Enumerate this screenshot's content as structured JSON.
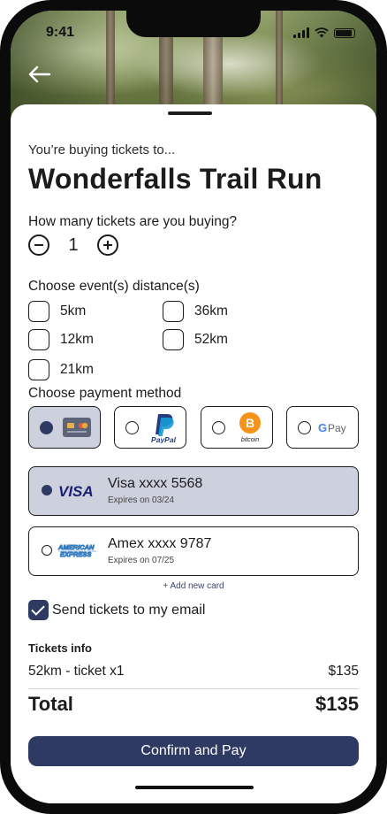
{
  "status_bar": {
    "time": "9:41"
  },
  "header": {
    "back_icon": "arrow-left-icon"
  },
  "sheet": {
    "subtitle": "You’re buying tickets to...",
    "title": "Wonderfalls Trail Run"
  },
  "tickets": {
    "question": "How many tickets are you buying?",
    "quantity": "1",
    "minus_icon": "minus-circle-icon",
    "plus_icon": "plus-circle-icon"
  },
  "distances": {
    "label": "Choose event(s) distance(s)",
    "options": [
      {
        "label": "5km",
        "checked": false
      },
      {
        "label": "36km",
        "checked": false
      },
      {
        "label": "12km",
        "checked": false
      },
      {
        "label": "52km",
        "checked": false
      },
      {
        "label": "21km",
        "checked": false
      }
    ]
  },
  "payment": {
    "label": "Choose payment method",
    "methods": [
      {
        "name": "card",
        "icon": "credit-card-icon",
        "selected": true
      },
      {
        "name": "PayPal",
        "icon": "paypal-logo",
        "selected": false
      },
      {
        "name": "bitcoin",
        "icon": "bitcoin-logo",
        "selected": false
      },
      {
        "name": "G Pay",
        "icon": "google-pay-logo",
        "selected": false
      }
    ],
    "cards": [
      {
        "brand": "VISA",
        "name": "Visa xxxx 5568",
        "expires": "Expires on 03/24",
        "selected": true
      },
      {
        "brand": "AMERICAN EXPRESS",
        "name": "Amex xxxx 9787",
        "expires": "Expires on 07/25",
        "selected": false
      }
    ],
    "add_card": "+ Add new card"
  },
  "email": {
    "label": "Send tickets to my email",
    "checked": true
  },
  "summary": {
    "title": "Tickets info",
    "item": "52km - ticket x1",
    "item_price": "$135",
    "total_label": "Total",
    "total_value": "$135"
  },
  "confirm_label": "Confirm and Pay",
  "colors": {
    "accent": "#2f3a63",
    "selected_bg": "#cdd0dd"
  }
}
